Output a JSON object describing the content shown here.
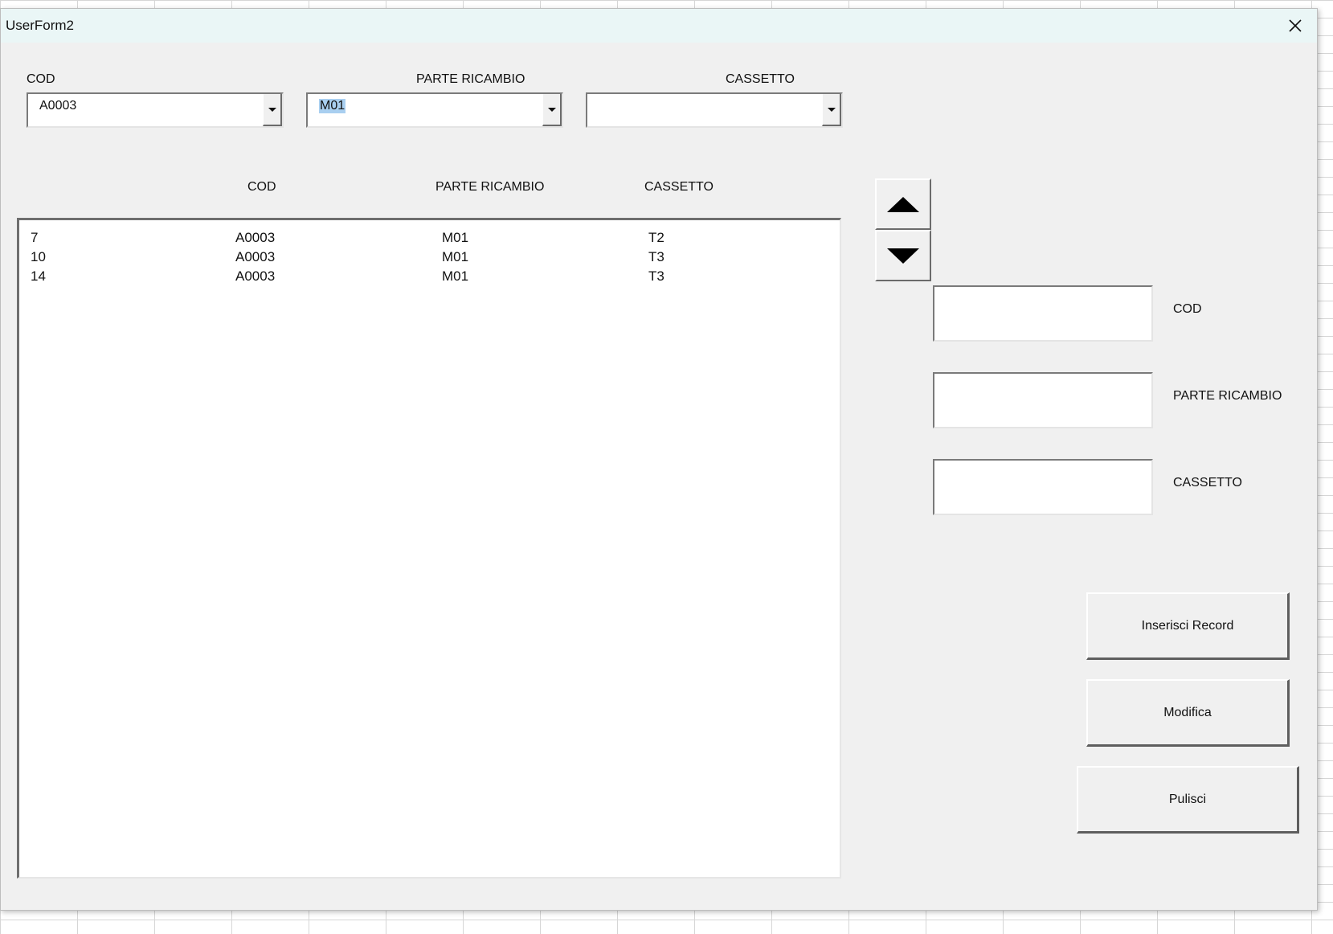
{
  "window": {
    "title": "UserForm2"
  },
  "filters": {
    "cod": {
      "label": "COD",
      "value": "A0003"
    },
    "parte": {
      "label": "PARTE RICAMBIO",
      "value": "M01"
    },
    "cassetto": {
      "label": "CASSETTO",
      "value": ""
    }
  },
  "list": {
    "headers": [
      "COD",
      "PARTE RICAMBIO",
      "CASSETTO"
    ],
    "rows": [
      [
        "7",
        "A0003",
        "M01",
        "T2"
      ],
      [
        "10",
        "A0003",
        "M01",
        "T3"
      ],
      [
        "14",
        "A0003",
        "M01",
        "T3"
      ]
    ]
  },
  "fields": {
    "cod_label": "COD",
    "parte_label": "PARTE RICAMBIO",
    "cassetto_label": "CASSETTO"
  },
  "buttons": {
    "insert": "Inserisci Record",
    "modify": "Modifica",
    "clear": "Pulisci"
  },
  "icons": {
    "close": "close-icon",
    "spin_up": "up-arrow-icon",
    "spin_down": "down-arrow-icon",
    "dropdown": "chevron-down-icon"
  }
}
